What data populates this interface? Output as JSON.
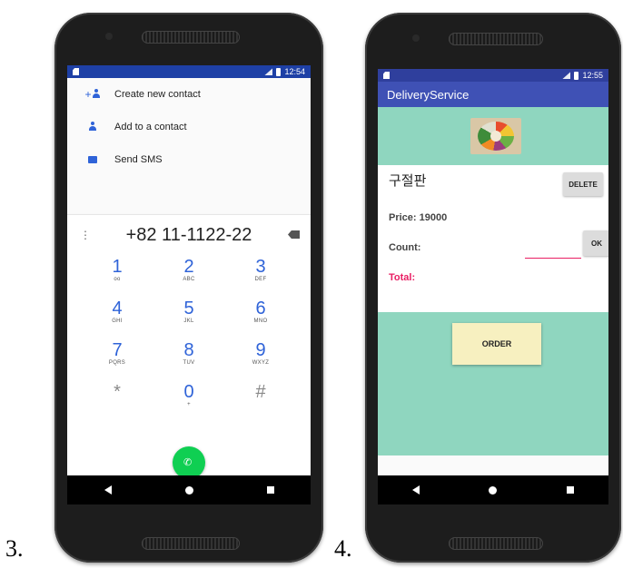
{
  "figure_labels": {
    "left": "3.",
    "right": "4."
  },
  "phone1": {
    "status_time": "12:54",
    "menu": [
      {
        "label": "Create new contact",
        "icon": "add-person-icon"
      },
      {
        "label": "Add to a contact",
        "icon": "person-icon"
      },
      {
        "label": "Send SMS",
        "icon": "message-icon"
      }
    ],
    "dialed_number": "+82 11-1122-22",
    "keys": [
      {
        "digit": "1",
        "letters": "ᴏᴏ"
      },
      {
        "digit": "2",
        "letters": "ABC"
      },
      {
        "digit": "3",
        "letters": "DEF"
      },
      {
        "digit": "4",
        "letters": "GHI"
      },
      {
        "digit": "5",
        "letters": "JKL"
      },
      {
        "digit": "6",
        "letters": "MNO"
      },
      {
        "digit": "7",
        "letters": "PQRS"
      },
      {
        "digit": "8",
        "letters": "TUV"
      },
      {
        "digit": "9",
        "letters": "WXYZ"
      },
      {
        "digit": "*",
        "letters": ""
      },
      {
        "digit": "0",
        "letters": "+"
      },
      {
        "digit": "#",
        "letters": ""
      }
    ]
  },
  "phone2": {
    "status_time": "12:55",
    "app_title": "DeliveryService",
    "item_name": "구절판",
    "delete_label": "DELETE",
    "price_label": "Price: 19000",
    "count_label": "Count:",
    "ok_label": "OK",
    "total_label": "Total:",
    "order_label": "ORDER"
  },
  "colors": {
    "dialer_status": "#1e40a6",
    "app_bar": "#3f51b5",
    "teal": "#8fd6bf",
    "accent_pink": "#e91e63",
    "call_green": "#0fcf52",
    "order_button": "#f7f0c0"
  }
}
